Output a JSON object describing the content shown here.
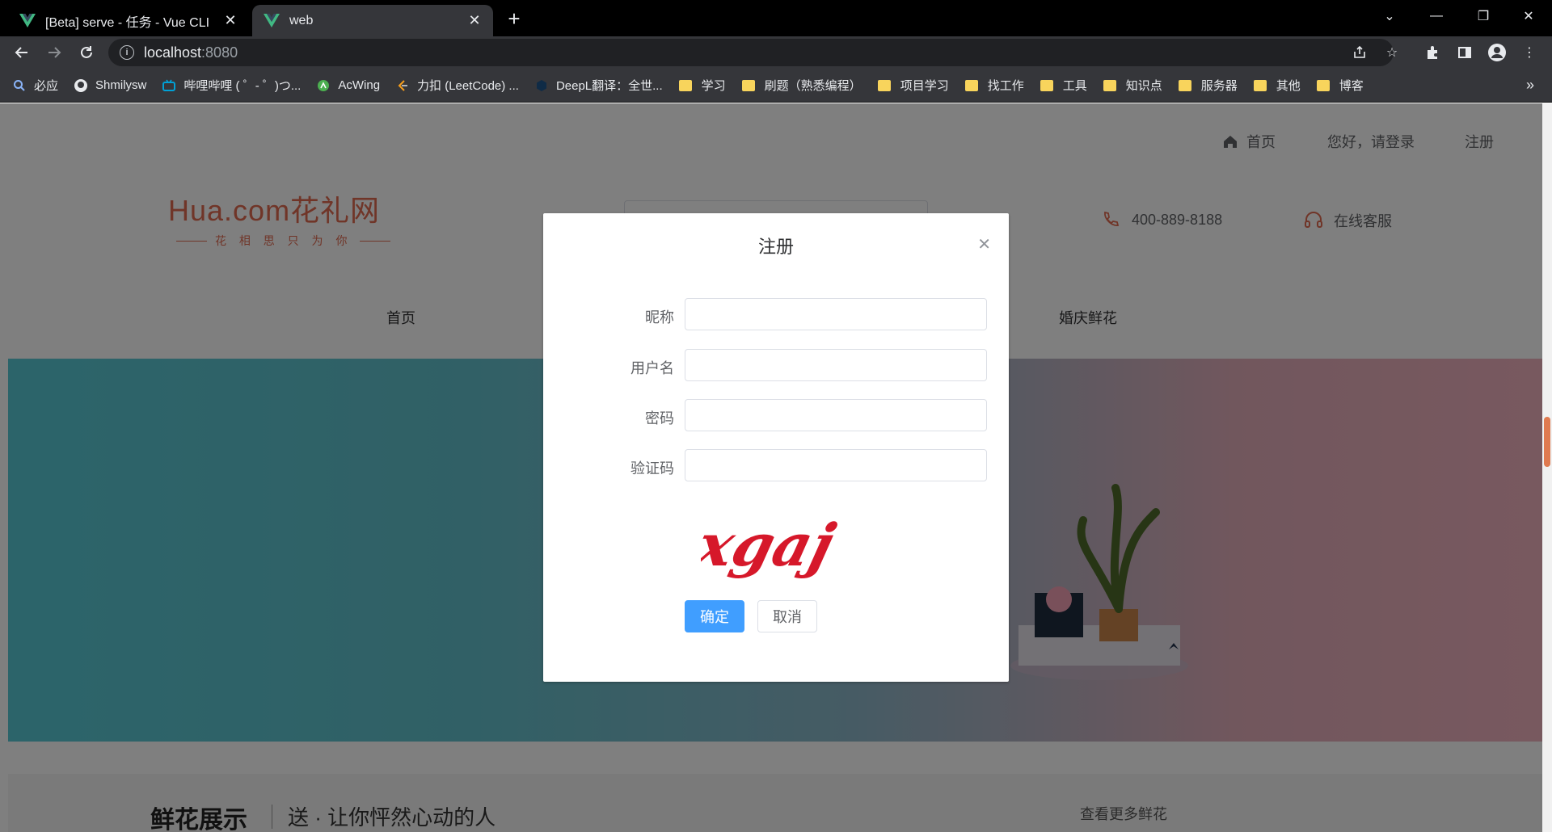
{
  "browser": {
    "tabs": [
      {
        "title": "[Beta] serve - 任务 - Vue CLI",
        "active": false
      },
      {
        "title": "web",
        "active": true
      }
    ],
    "url_host": "localhost",
    "url_port": ":8080",
    "bookmarks": [
      {
        "label": "必应",
        "icon": "search-icon"
      },
      {
        "label": "Shmilysw",
        "icon": "github-icon"
      },
      {
        "label": "哔哩哔哩 ( ゜- ゜)つ...",
        "icon": "bilibili-icon"
      },
      {
        "label": "AcWing",
        "icon": "acwing-icon"
      },
      {
        "label": "力扣 (LeetCode) ...",
        "icon": "leetcode-icon"
      },
      {
        "label": "DeepL翻译：全世...",
        "icon": "deepl-icon"
      },
      {
        "label": "学习",
        "icon": "folder-icon"
      },
      {
        "label": "刷题（熟悉编程）",
        "icon": "folder-icon"
      },
      {
        "label": "项目学习",
        "icon": "folder-icon"
      },
      {
        "label": "找工作",
        "icon": "folder-icon"
      },
      {
        "label": "工具",
        "icon": "folder-icon"
      },
      {
        "label": "知识点",
        "icon": "folder-icon"
      },
      {
        "label": "服务器",
        "icon": "folder-icon"
      },
      {
        "label": "其他",
        "icon": "folder-icon"
      },
      {
        "label": "博客",
        "icon": "folder-icon"
      }
    ],
    "more": "»"
  },
  "site": {
    "topnav": {
      "home": "首页",
      "login": "您好，请登录",
      "register": "注册"
    },
    "logo": {
      "main": "Hua.com花礼网",
      "sub": "花 相 思 只 为 你"
    },
    "phone": "400-889-8188",
    "service": "在线客服",
    "mainnav": {
      "home": "首页",
      "wedding": "婚庆鲜花"
    },
    "section": {
      "title": "鲜花展示",
      "subtitle": "送 · 让你怦然心动的人",
      "more": "查看更多鲜花"
    }
  },
  "dialog": {
    "title": "注册",
    "fields": [
      {
        "label": "昵称",
        "value": ""
      },
      {
        "label": "用户名",
        "value": ""
      },
      {
        "label": "密码",
        "value": ""
      },
      {
        "label": "验证码",
        "value": ""
      }
    ],
    "captcha_text": "xgaj",
    "confirm": "确定",
    "cancel": "取消"
  },
  "colors": {
    "primary": "#409eff",
    "brand": "#e06a50",
    "captcha": "#d6182a"
  }
}
